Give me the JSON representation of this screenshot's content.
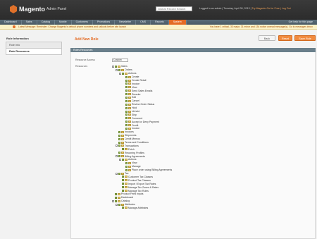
{
  "header": {
    "logo_text": "Magento",
    "logo_subtext": "Admin Panel",
    "search_placeholder": "Global Record Search",
    "user_info": "Logged in as admin | Tuesday, April 30, 2013 |",
    "user_link": "Try Magento Go for Free | Log Out"
  },
  "nav": {
    "items": [
      "Dashboard",
      "Sales",
      "Catalog",
      "Mobile",
      "Customers",
      "Promotions",
      "Newsletter",
      "CMS",
      "Reports",
      "System"
    ],
    "active_index": 9,
    "help": "Get help for this page"
  },
  "notice": {
    "text": "Latest Message: Reminder: Change Magento's default phone numbers and callouts before site launch",
    "right": "You have 1 critical, 33 major, 31 minor and 134 notice unread message(s). Go to messages inbox"
  },
  "sidebar": {
    "title": "Role Information",
    "tabs": [
      "Role Info",
      "Role Resources"
    ],
    "active_index": 1
  },
  "main": {
    "title": "Add New Role",
    "buttons": {
      "back": "Back",
      "reset": "Reset",
      "save": "Save Role"
    },
    "section_title": "Roles Resources",
    "resource_access_label": "Resource Access",
    "resource_access_value": "Custom",
    "resources_label": "Resources"
  },
  "tree": [
    {
      "label": "Sales",
      "depth": 0,
      "checked": true,
      "toggle": true
    },
    {
      "label": "Orders",
      "depth": 1,
      "checked": true,
      "toggle": true
    },
    {
      "label": "Actions",
      "depth": 2,
      "checked": true,
      "toggle": true
    },
    {
      "label": "Create",
      "depth": 3,
      "checked": true
    },
    {
      "label": "Create Retail",
      "depth": 3,
      "checked": true
    },
    {
      "label": "Invoice",
      "depth": 3,
      "checked": true
    },
    {
      "label": "View",
      "depth": 3,
      "checked": true
    },
    {
      "label": "Send Sales Emails",
      "depth": 3,
      "checked": true
    },
    {
      "label": "Reorder",
      "depth": 3,
      "checked": true
    },
    {
      "label": "Edit",
      "depth": 3,
      "checked": true
    },
    {
      "label": "Cancel",
      "depth": 3,
      "checked": true
    },
    {
      "label": "Review Order Status",
      "depth": 3,
      "checked": true
    },
    {
      "label": "Hold",
      "depth": 3,
      "checked": true
    },
    {
      "label": "Unhold",
      "depth": 3,
      "checked": true
    },
    {
      "label": "Ship",
      "depth": 3,
      "checked": true
    },
    {
      "label": "Comment",
      "depth": 3,
      "checked": true
    },
    {
      "label": "Accept or Deny Payment",
      "depth": 3,
      "checked": true
    },
    {
      "label": "Credit",
      "depth": 3,
      "checked": true
    },
    {
      "label": "Invoice",
      "depth": 3,
      "checked": true
    },
    {
      "label": "Invoices",
      "depth": 1,
      "checked": true
    },
    {
      "label": "Shipments",
      "depth": 1,
      "checked": true
    },
    {
      "label": "Credit Memos",
      "depth": 1,
      "checked": true
    },
    {
      "label": "Terms and Conditions",
      "depth": 1,
      "checked": true
    },
    {
      "label": "Transactions",
      "depth": 1,
      "checked": true,
      "toggle": true
    },
    {
      "label": "Fetch",
      "depth": 2,
      "checked": true
    },
    {
      "label": "Recurring Profiles",
      "depth": 1,
      "checked": true
    },
    {
      "label": "Billing Agreements",
      "depth": 1,
      "checked": true,
      "toggle": true
    },
    {
      "label": "Actions",
      "depth": 2,
      "checked": true,
      "toggle": true
    },
    {
      "label": "View",
      "depth": 3,
      "checked": true
    },
    {
      "label": "Manage",
      "depth": 3,
      "checked": true
    },
    {
      "label": "Place order using Billing Agreements",
      "depth": 3,
      "checked": true
    },
    {
      "label": "Tax",
      "depth": 1,
      "checked": true,
      "toggle": true
    },
    {
      "label": "Customer Tax Classes",
      "depth": 2,
      "checked": true
    },
    {
      "label": "Product Tax Classes",
      "depth": 2,
      "checked": true
    },
    {
      "label": "Import / Export Tax Rates",
      "depth": 2,
      "checked": true
    },
    {
      "label": "Manage Tax Zones & Rates",
      "depth": 2,
      "checked": true
    },
    {
      "label": "Manage Tax Rules",
      "depth": 2,
      "checked": true
    },
    {
      "label": "Product Feed Inputs",
      "depth": 0,
      "checked": true
    },
    {
      "label": "Dashboard",
      "depth": 0,
      "checked": true
    },
    {
      "label": "Catalog",
      "depth": 0,
      "checked": true,
      "toggle": true
    },
    {
      "label": "Attributes",
      "depth": 1,
      "checked": true,
      "toggle": true
    },
    {
      "label": "Manage Attributes",
      "depth": 2,
      "checked": true
    }
  ]
}
